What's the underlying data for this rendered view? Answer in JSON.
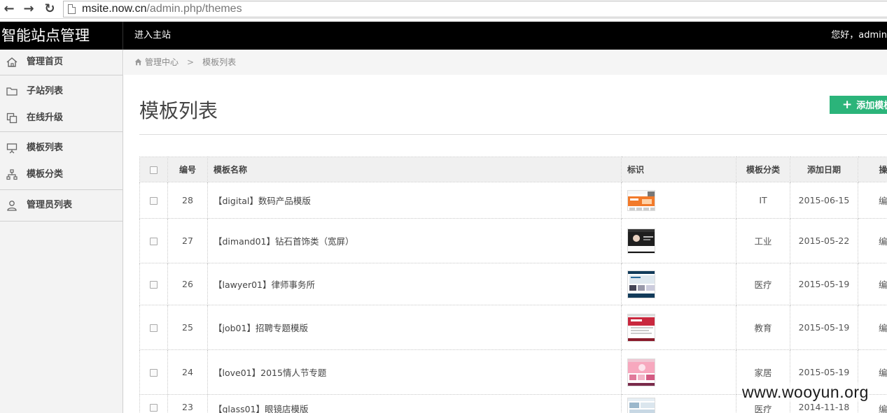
{
  "browser": {
    "url_host": "msite.now.cn",
    "url_path": "/admin.php/themes"
  },
  "header": {
    "brand": "智能站点管理",
    "top_link": "进入主站",
    "greeting": "您好，admin"
  },
  "sidebar": {
    "items": [
      {
        "label": "管理首页",
        "icon": "home-icon"
      },
      {
        "label": "子站列表",
        "icon": "folder-icon"
      },
      {
        "label": "在线升级",
        "icon": "copy-icon"
      },
      {
        "label": "模板列表",
        "icon": "presentation-icon"
      },
      {
        "label": "模板分类",
        "icon": "sitemap-icon"
      },
      {
        "label": "管理员列表",
        "icon": "user-icon"
      }
    ]
  },
  "breadcrumb": {
    "root": "管理中心",
    "separator": ">",
    "current": "模板列表"
  },
  "main": {
    "title": "模板列表",
    "add_button": "添加模板"
  },
  "table": {
    "headers": {
      "id": "编号",
      "name": "模板名称",
      "mark": "标识",
      "category": "模板分类",
      "date": "添加日期",
      "action": "操作"
    },
    "rows": [
      {
        "id": "28",
        "name": "【digital】数码产品模版",
        "category": "IT",
        "date": "2015-06-15",
        "action": "编辑",
        "thumb": "orange"
      },
      {
        "id": "27",
        "name": "【dimand01】钻石首饰类（宽屏）",
        "category": "工业",
        "date": "2015-05-22",
        "action": "编辑",
        "thumb": "dark"
      },
      {
        "id": "26",
        "name": "【lawyer01】律师事务所",
        "category": "医疗",
        "date": "2015-05-19",
        "action": "编辑",
        "thumb": "navy"
      },
      {
        "id": "25",
        "name": "【job01】招聘专题模版",
        "category": "教育",
        "date": "2015-05-19",
        "action": "编辑",
        "thumb": "red"
      },
      {
        "id": "24",
        "name": "【love01】2015情人节专题",
        "category": "家居",
        "date": "2015-05-19",
        "action": "编辑",
        "thumb": "pink"
      },
      {
        "id": "23",
        "name": "【glass01】眼镜店模版",
        "category": "医疗",
        "date": "2014-11-18",
        "action": "编辑",
        "thumb": "light"
      }
    ]
  },
  "colors": {
    "topbar": "#000000",
    "add_button": "#2bb47a",
    "sidebar_bg": "#f3f3f3"
  },
  "watermark": "www.wooyun.org"
}
